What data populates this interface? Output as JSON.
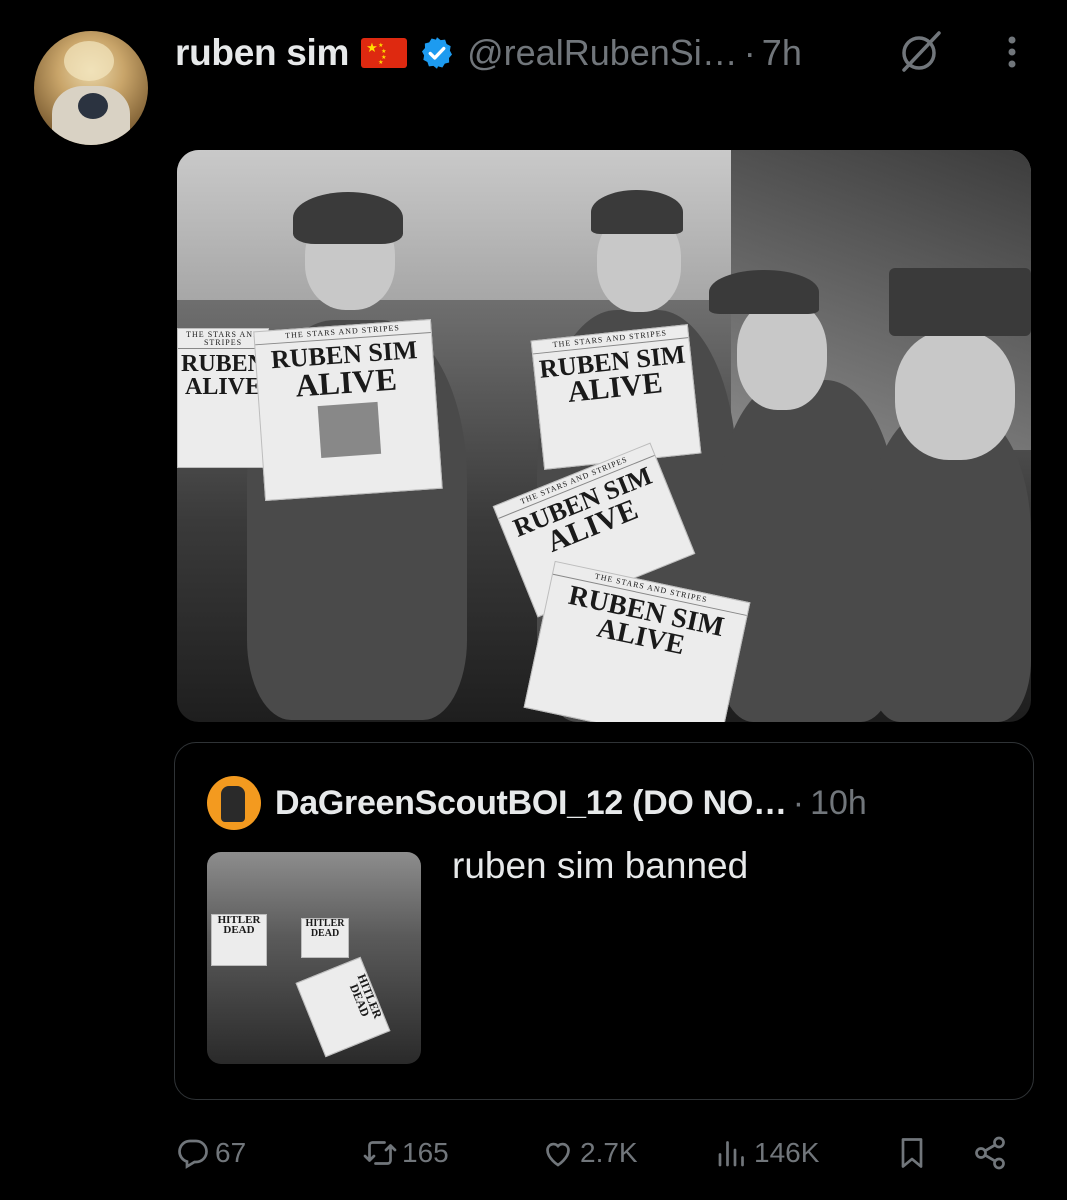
{
  "post": {
    "author": {
      "display_name": "ruben sim",
      "handle": "@realRubenSi…",
      "time": "7h",
      "separator": "·",
      "flag_icon": "china-flag-icon",
      "verified_icon": "verified-badge-icon"
    },
    "image": {
      "headlines": [
        {
          "line1": "RUBEN SIM",
          "line2": "ALIVE"
        },
        {
          "line1": "RUBEN",
          "line2": "ALIVE"
        },
        {
          "line1": "RUBEN SIM",
          "line2": "ALIVE"
        },
        {
          "line1": "RUBEN SIM",
          "line2": "ALIVE"
        },
        {
          "line1": "RUBEN SIM",
          "line2": "ALIVE"
        }
      ],
      "masthead": "THE STARS AND STRIPES"
    }
  },
  "quote": {
    "display_name": "DaGreenScoutBOI_12 (DO NO…",
    "separator": "·",
    "time": "10h",
    "text": "ruben sim banned",
    "thumb_headlines": [
      "HITLER DEAD",
      "HITLER DEAD",
      "HITLER DEAD"
    ]
  },
  "actions": {
    "replies": "67",
    "reposts": "165",
    "likes": "2.7K",
    "views": "146K"
  },
  "colors": {
    "background": "#000000",
    "text": "#e7e9ea",
    "muted": "#71767b",
    "verified": "#1d9bf0",
    "border": "#2f3336"
  }
}
